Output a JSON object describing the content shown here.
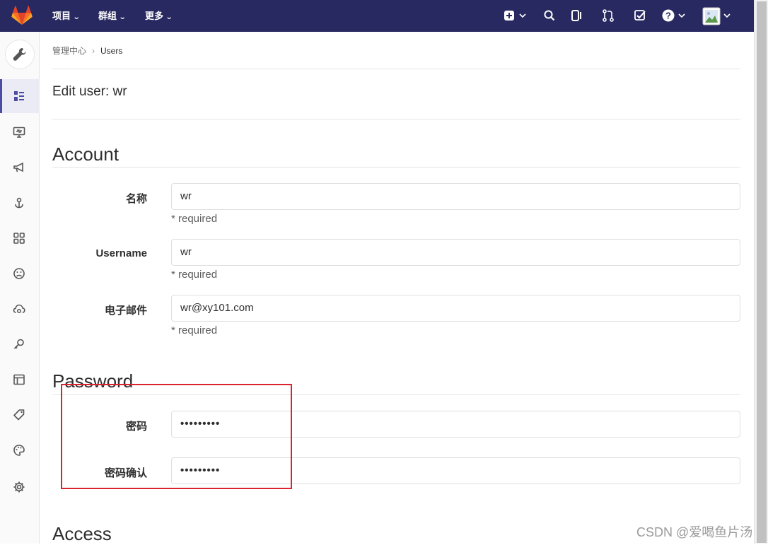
{
  "topbar": {
    "nav": [
      {
        "label": "项目"
      },
      {
        "label": "群组"
      },
      {
        "label": "更多"
      }
    ],
    "icons": [
      "plus-square-icon",
      "search-icon",
      "issues-icon",
      "merge-request-icon",
      "todo-icon",
      "help-icon",
      "avatar"
    ]
  },
  "sidebar": {
    "header_icon": "wrench-icon",
    "items": [
      "overview-icon",
      "monitoring-icon",
      "messages-icon",
      "hooks-icon",
      "applications-icon",
      "abuse-reports-icon",
      "kubernetes-icon",
      "deploy-keys-icon",
      "service-templates-icon",
      "labels-icon",
      "appearance-icon",
      "settings-icon"
    ]
  },
  "breadcrumb": {
    "parent": "管理中心",
    "current": "Users"
  },
  "page": {
    "title": "Edit user: wr"
  },
  "account": {
    "title": "Account",
    "fields": [
      {
        "label": "名称",
        "value": "wr",
        "help": "* required"
      },
      {
        "label": "Username",
        "value": "wr",
        "help": "* required"
      },
      {
        "label": "电子邮件",
        "value": "wr@xy101.com",
        "help": "* required"
      }
    ]
  },
  "password": {
    "title": "Password",
    "fields": [
      {
        "label": "密码",
        "value": "•••••••••"
      },
      {
        "label": "密码确认",
        "value": "•••••••••"
      }
    ]
  },
  "access": {
    "title": "Access"
  },
  "watermark": "CSDN @爱喝鱼片汤",
  "colors": {
    "topbar": "#292961",
    "active_sidebar": "#4b4ba3",
    "highlight_box": "#d9232e",
    "logo": "#e24329"
  }
}
